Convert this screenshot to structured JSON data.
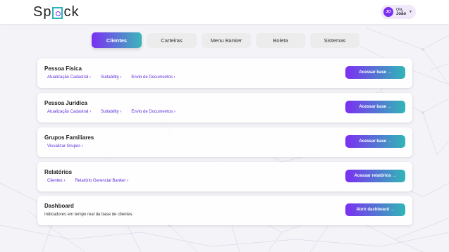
{
  "app": {
    "logo_prefix": "Sp",
    "logo_suffix": "ck"
  },
  "user": {
    "initials": "JO",
    "greeting": "Olá,",
    "name": "João"
  },
  "tabs": [
    {
      "label": "Clientes",
      "active": true
    },
    {
      "label": "Carteiras",
      "active": false
    },
    {
      "label": "Menu Banker",
      "active": false
    },
    {
      "label": "Boleta",
      "active": false
    },
    {
      "label": "Sistemas",
      "active": false
    }
  ],
  "cards": [
    {
      "title": "Pessoa Física",
      "links": [
        "Atualização Cadastral ›",
        "Suitability ›",
        "Envio de Documentos ›"
      ],
      "button": "Acessar base →"
    },
    {
      "title": "Pessoa Jurídica",
      "links": [
        "Atualização Cadastral ›",
        "Suitability ›",
        "Envio de Documentos ›"
      ],
      "button": "Acessar base →"
    },
    {
      "title": "Grupos Familiares",
      "links": [
        "Visualizar Grupos ›"
      ],
      "button": "Acessar base →"
    },
    {
      "title": "Relatórios",
      "links": [
        "Clientes ›",
        "Relatório Gerencial Banker ›"
      ],
      "button": "Acessar relatórios →"
    },
    {
      "title": "Dashboard",
      "description": "Indicadores em tempo real da base de clientes.",
      "button": "Abrir dashboard →"
    }
  ],
  "colors": {
    "accent": "#7b2ff2",
    "accent2": "#30b6b6"
  }
}
